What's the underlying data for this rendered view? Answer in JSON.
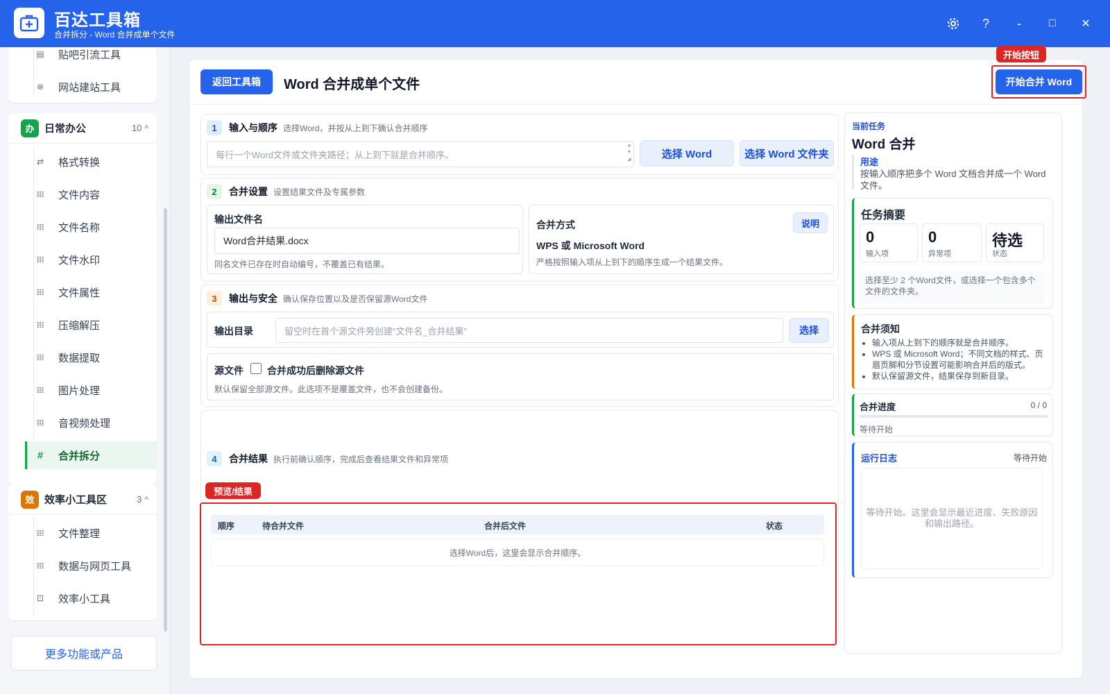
{
  "app": {
    "title": "百达工具箱",
    "subtitle": "合并拆分 - Word 合并成单个文件",
    "window_buttons": [
      "settings-icon",
      "help-icon",
      "minimize-icon",
      "maximize-icon",
      "close-icon"
    ],
    "help_glyph": "?",
    "minimize_glyph": "-",
    "maximize_glyph": "□",
    "close_glyph": "✕",
    "accent_color": "#2563eb"
  },
  "sidebar": {
    "top_items": [
      {
        "label": "贴吧引流工具",
        "icon": "doc-icon"
      },
      {
        "label": "网站建站工具",
        "icon": "globe-icon"
      }
    ],
    "group_office": {
      "badge": "办",
      "name": "日常办公",
      "count": "10",
      "chevron": "^",
      "badge_color": "#16a34a",
      "items": [
        {
          "label": "格式转换",
          "icon": "swap-icon",
          "glyph": "⇄"
        },
        {
          "label": "文件内容",
          "icon": "grid-icon",
          "glyph": "𝍖"
        },
        {
          "label": "文件名称",
          "icon": "grid-icon",
          "glyph": "𝍖"
        },
        {
          "label": "文件水印",
          "icon": "grid-icon",
          "glyph": "𝍖"
        },
        {
          "label": "文件属性",
          "icon": "grid-icon",
          "glyph": "𝍖"
        },
        {
          "label": "压缩解压",
          "icon": "grid-icon",
          "glyph": "𝍖"
        },
        {
          "label": "数据提取",
          "icon": "grid-icon",
          "glyph": "𝍖"
        },
        {
          "label": "图片处理",
          "icon": "grid-icon",
          "glyph": "𝍖"
        },
        {
          "label": "音视频处理",
          "icon": "grid-icon",
          "glyph": "𝍖"
        },
        {
          "label": "合并拆分",
          "icon": "hash-icon",
          "glyph": "#",
          "active": true
        }
      ]
    },
    "group_efficiency": {
      "badge": "效",
      "name": "效率小工具区",
      "count": "3",
      "chevron": "^",
      "badge_color": "#d97706",
      "items": [
        {
          "label": "文件整理",
          "icon": "grid-icon",
          "glyph": "𝍖"
        },
        {
          "label": "数据与网页工具",
          "icon": "grid-icon",
          "glyph": "𝍖"
        },
        {
          "label": "效率小工具",
          "icon": "toolbox-icon",
          "glyph": "⊡"
        }
      ]
    },
    "more_label": "更多功能或产品"
  },
  "main": {
    "back_label": "返回工具箱",
    "page_title": "Word 合并成单个文件",
    "start_tag": "开始按钮",
    "start_label": "开始合并 Word",
    "sections": {
      "input": {
        "num": "1",
        "title": "输入与顺序",
        "desc": "选择Word，并按从上到下确认合并顺序",
        "placeholder": "每行一个Word文件或文件夹路径；从上到下就是合并顺序。",
        "btn_select_word": "选择 Word",
        "btn_select_folder": "选择 Word 文件夹"
      },
      "settings": {
        "num": "2",
        "title": "合并设置",
        "desc": "设置结果文件及专属参数",
        "output_name_label": "输出文件名",
        "output_name_value": "Word合并结果.docx",
        "output_name_hint": "同名文件已存在时自动编号，不覆盖已有结果。",
        "method_label": "合并方式",
        "method_help": "说明",
        "method_value": "WPS 或 Microsoft Word",
        "method_hint": "严格按照输入项从上到下的顺序生成一个结果文件。"
      },
      "output": {
        "num": "3",
        "title": "输出与安全",
        "desc": "确认保存位置以及是否保留源Word文件",
        "dir_label": "输出目录",
        "dir_placeholder": "留空时在首个源文件旁创建“文件名_合并结果”",
        "dir_button": "选择",
        "source_label": "源文件",
        "delete_label": "合并成功后删除源文件",
        "delete_checked": false,
        "source_hint": "默认保留全部源文件。此选项不是覆盖文件，也不会创建备份。"
      },
      "result": {
        "num": "4",
        "title": "合并结果",
        "desc": "执行前确认顺序，完成后查看结果文件和异常项",
        "preview_tag": "预览/结果",
        "columns": [
          "顺序",
          "待合并文件",
          "合并后文件",
          "状态"
        ],
        "empty_text": "选择Word后，这里会显示合并顺序。"
      }
    }
  },
  "right": {
    "current_label": "当前任务",
    "current_title": "Word 合并",
    "purpose_label": "用途",
    "purpose_text": "按输入顺序把多个 Word 文档合并成一个 Word 文件。",
    "summary_title": "任务摘要",
    "stats": [
      {
        "value": "0",
        "label": "输入项"
      },
      {
        "value": "0",
        "label": "异常项"
      },
      {
        "value": "待选",
        "label": "状态"
      }
    ],
    "summary_hint": "选择至少 2 个Word文件，或选择一个包含多个文件的文件夹。",
    "notes_title": "合并须知",
    "notes": [
      "输入项从上到下的顺序就是合并顺序。",
      "WPS 或 Microsoft Word；不同文档的样式、页眉页脚和分节设置可能影响合并后的版式。",
      "默认保留源文件，结果保存到新目录。"
    ],
    "progress_title": "合并进度",
    "progress_count": "0 / 0",
    "progress_status": "等待开始",
    "progress_fraction": 0,
    "log_title": "运行日志",
    "log_status": "等待开始",
    "log_placeholder": "等待开始。这里会显示最近进度、失败原因和输出路径。"
  }
}
